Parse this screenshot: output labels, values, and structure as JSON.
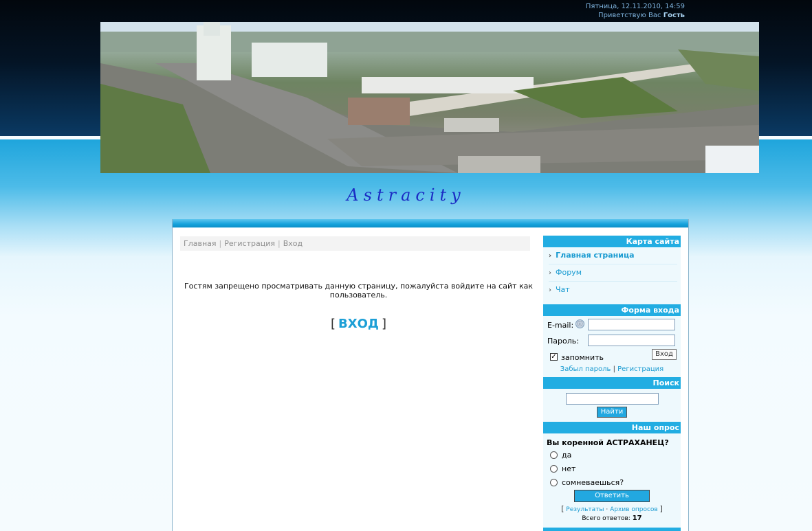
{
  "header": {
    "datetime": "Пятница, 12.11.2010, 14:59",
    "greeting": "Приветствую Вас",
    "user": "Гость"
  },
  "site_title": "Astracity",
  "breadcrumb": {
    "home": "Главная",
    "register": "Регистрация",
    "login": "Вход",
    "separator": "|"
  },
  "main": {
    "message": "Гостям запрещено просматривать данную страницу, пожалуйста войдите на сайт как пользователь.",
    "enter_open": "[",
    "enter_label": "ВХОД",
    "enter_close": "]"
  },
  "sitemap": {
    "title": "Карта сайта",
    "items": [
      {
        "label": "Главная страница",
        "bold": true
      },
      {
        "label": "Форум",
        "bold": false
      },
      {
        "label": "Чат",
        "bold": false
      }
    ]
  },
  "login_form": {
    "title": "Форма входа",
    "email_label": "E-mail:",
    "password_label": "Пароль:",
    "remember_label": "запомнить",
    "remember_checked": true,
    "submit_label": "Вход",
    "forgot_label": "Забыл пароль",
    "register_label": "Регистрация",
    "separator": "|",
    "email_value": "",
    "password_value": ""
  },
  "search": {
    "title": "Поиск",
    "button_label": "Найти",
    "value": ""
  },
  "poll": {
    "title": "Наш опрос",
    "question": "Вы коренной АСТРАХАНЕЦ?",
    "options": [
      "да",
      "нет",
      "сомневаешься?"
    ],
    "vote_label": "Ответить",
    "results_label": "Результаты",
    "archive_label": "Архив опросов",
    "bullet": "·",
    "bracket_open": "[",
    "bracket_close": "]",
    "total_label": "Всего ответов:",
    "total_value": "17"
  },
  "colors": {
    "accent": "#22ade2",
    "link": "#1a9bd1",
    "title": "#1b2cc4"
  },
  "icons": {
    "bullet": "chevron-right-icon",
    "openid": "openid-icon",
    "checkbox": "checkbox-checked-icon"
  }
}
